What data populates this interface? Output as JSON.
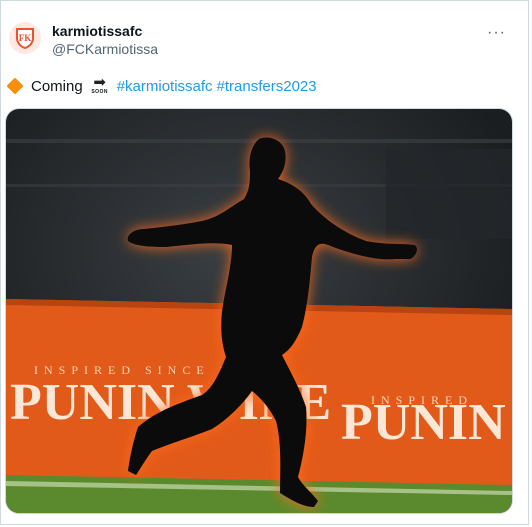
{
  "account": {
    "display_name": "karmiotissafc",
    "handle": "@FCKarmiotissa",
    "avatar_text": "FK"
  },
  "tweet": {
    "word_coming": "Coming",
    "soon_label": "SOON",
    "hashtags": [
      "#karmiotissafc",
      "#transfers2023"
    ]
  },
  "more_label": "···",
  "media": {
    "banner_tagline": "INSPIRED SINCE 1922",
    "banner_brand": "PUNIN WINE",
    "banner_tagline2": "INSPIRED",
    "banner_brand2": "PUNIN"
  },
  "colors": {
    "hashtag": "#1d9bf0",
    "banner": "#e25a1a",
    "glow": "#ff6a1a"
  },
  "icons": [
    "orange-diamond-icon",
    "soon-arrow-icon",
    "more-icon",
    "club-crest-icon"
  ]
}
